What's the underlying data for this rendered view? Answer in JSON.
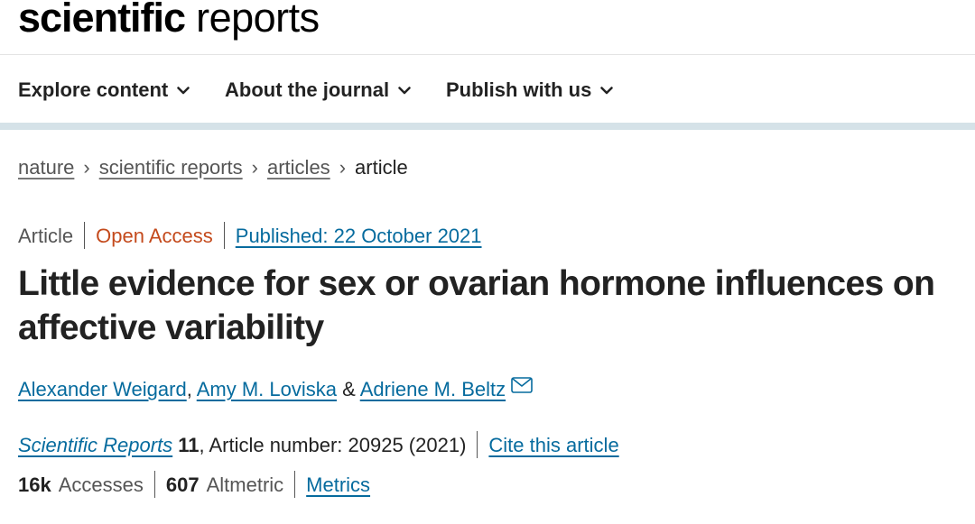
{
  "header": {
    "logo_bold": "scientific",
    "logo_light": "reports"
  },
  "nav": {
    "items": [
      {
        "label": "Explore content"
      },
      {
        "label": "About the journal"
      },
      {
        "label": "Publish with us"
      }
    ]
  },
  "breadcrumb": {
    "items": [
      "nature",
      "scientific reports",
      "articles"
    ],
    "current": "article",
    "separator": "›"
  },
  "article": {
    "type": "Article",
    "access": "Open Access",
    "published": "Published: 22 October 2021",
    "title": "Little evidence for sex or ovarian hormone influences on affective variability",
    "authors": [
      {
        "name": "Alexander Weigard"
      },
      {
        "name": "Amy M. Loviska"
      },
      {
        "name": "Adriene M. Beltz"
      }
    ],
    "author_separators": [
      ",",
      "&"
    ],
    "journal": "Scientific Reports",
    "volume": "11",
    "article_number": ", Article number: 20925 (2021)",
    "cite_label": "Cite this article",
    "stats": {
      "accesses_count": "16k",
      "accesses_label": "Accesses",
      "altmetric_count": "607",
      "altmetric_label": "Altmetric",
      "metrics_label": "Metrics"
    }
  },
  "colors": {
    "link": "#066b9e",
    "open_access": "#c44a1c",
    "nav_border": "#d5e2e8"
  }
}
